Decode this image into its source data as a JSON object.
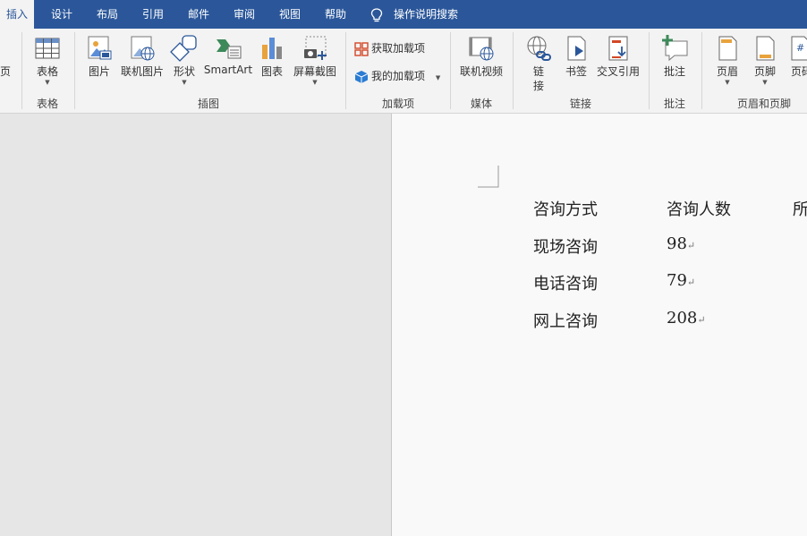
{
  "tabs": [
    {
      "label": "插入",
      "active": true
    },
    {
      "label": "设计"
    },
    {
      "label": "布局"
    },
    {
      "label": "引用"
    },
    {
      "label": "邮件"
    },
    {
      "label": "审阅"
    },
    {
      "label": "视图"
    },
    {
      "label": "帮助"
    }
  ],
  "tell_me": "操作说明搜索",
  "ribbon": {
    "cut_page_label": "页",
    "table_label": "表格",
    "group_table": "表格",
    "picture": "图片",
    "online_picture": "联机图片",
    "shapes": "形状",
    "smartart": "SmartArt",
    "chart": "图表",
    "screenshot": "屏幕截图",
    "group_illustrations": "插图",
    "get_addins": "获取加载项",
    "my_addins": "我的加载项",
    "group_addins": "加载项",
    "online_video": "联机视频",
    "group_media": "媒体",
    "link_line1": "链",
    "link_line2": "接",
    "bookmark": "书签",
    "cross_reference": "交叉引用",
    "group_links": "链接",
    "comment": "批注",
    "group_comments": "批注",
    "header": "页眉",
    "footer": "页脚",
    "page_number_partial": "页码",
    "group_header_footer": "页眉和页脚"
  },
  "document": {
    "headers": [
      "咨询方式",
      "咨询人数",
      "所"
    ],
    "rows": [
      {
        "method": "现场咨询",
        "count": "98"
      },
      {
        "method": "电话咨询",
        "count": "79"
      },
      {
        "method": "网上咨询",
        "count": "208"
      }
    ],
    "para_mark": "↵"
  },
  "colors": {
    "accent": "#2b579a",
    "ribbon_bg": "#f3f3f3"
  }
}
